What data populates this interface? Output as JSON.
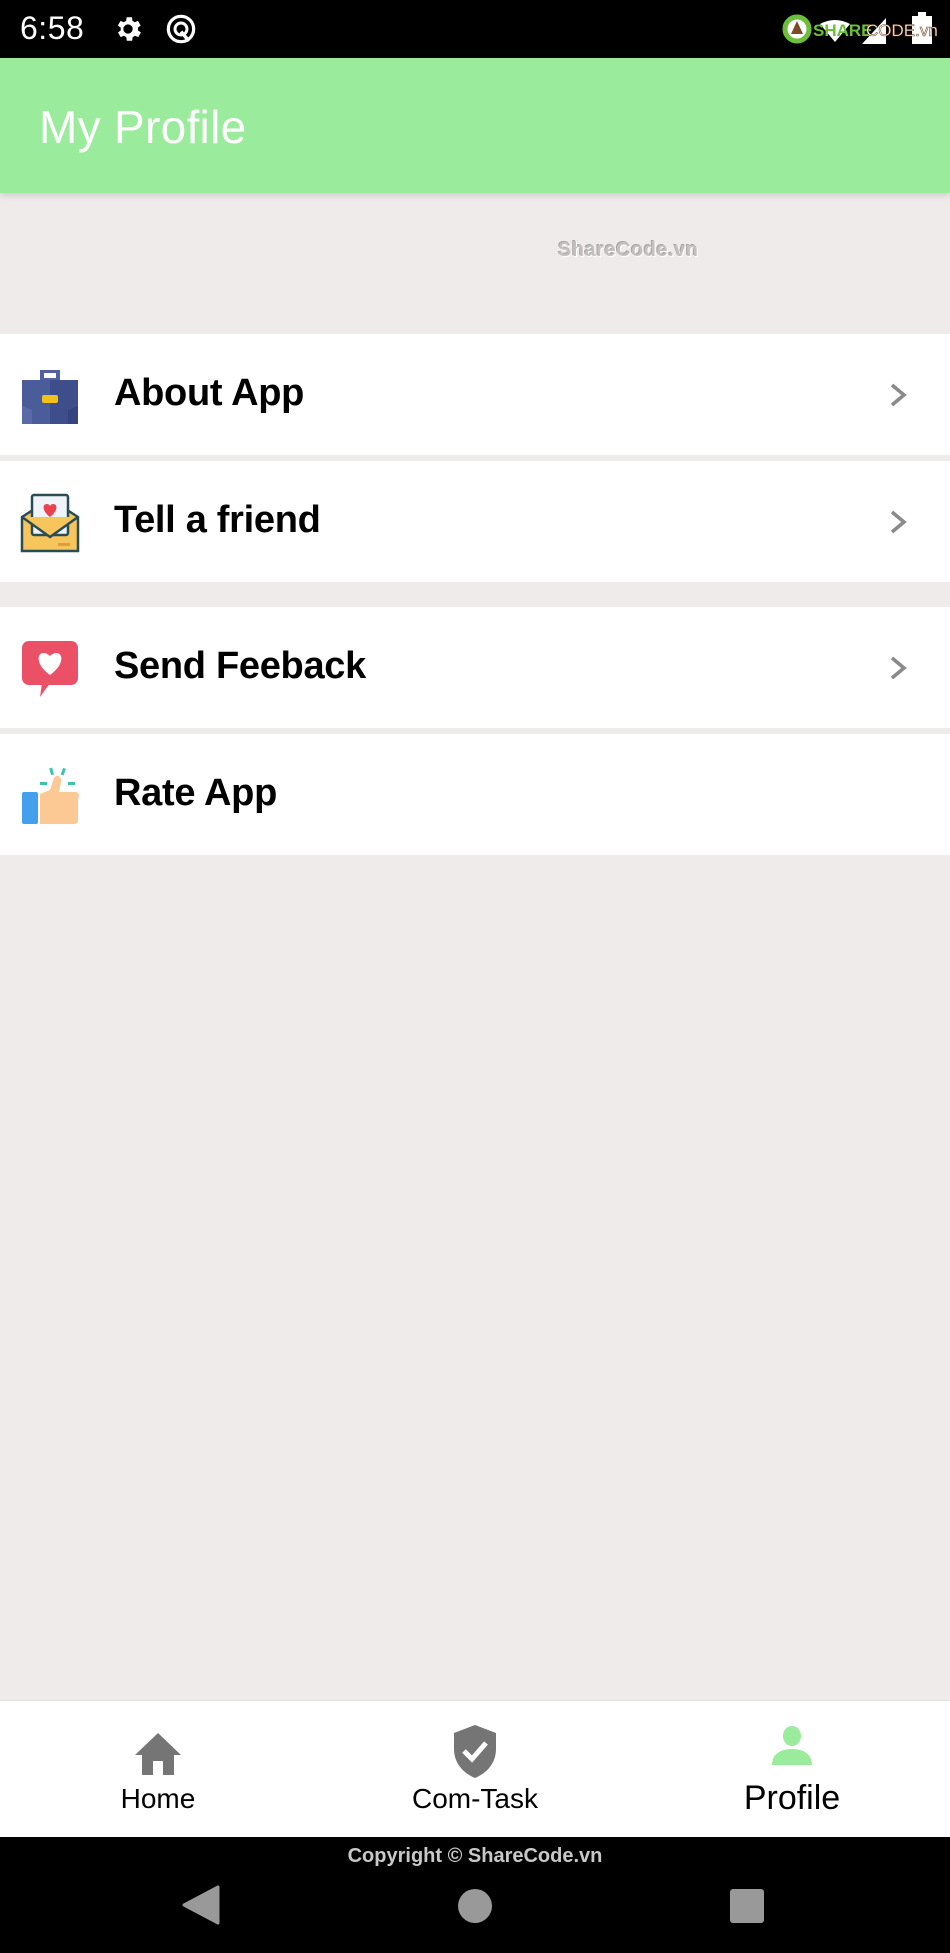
{
  "status_bar": {
    "time": "6:58",
    "icons": [
      "gear-icon",
      "q-badge-icon",
      "wifi-icon",
      "signal-icon",
      "battery-icon"
    ],
    "watermark_logo_text_green": "SHARE",
    "watermark_logo_text_gray": "CODE.vn"
  },
  "header": {
    "title": "My Profile",
    "background_color": "#9aeb9c"
  },
  "watermark": "ShareCode.vn",
  "menu": {
    "items": [
      {
        "label": "About App",
        "icon": "briefcase-icon",
        "has_chevron": true
      },
      {
        "label": "Tell a friend",
        "icon": "envelope-heart-icon",
        "has_chevron": true
      },
      {
        "label": "Send Feeback",
        "icon": "heart-chat-icon",
        "has_chevron": true
      },
      {
        "label": "Rate App",
        "icon": "thumbs-up-icon",
        "has_chevron": false
      }
    ]
  },
  "bottom_nav": {
    "items": [
      {
        "label": "Home",
        "icon": "home-icon",
        "active": false
      },
      {
        "label": "Com-Task",
        "icon": "shield-check-icon",
        "active": false
      },
      {
        "label": "Profile",
        "icon": "person-icon",
        "active": true
      }
    ],
    "active_color": "#9aeb9c",
    "inactive_color": "#757575"
  },
  "system_nav": {
    "copyright": "Copyright © ShareCode.vn",
    "buttons": [
      "back",
      "home",
      "recents"
    ]
  }
}
